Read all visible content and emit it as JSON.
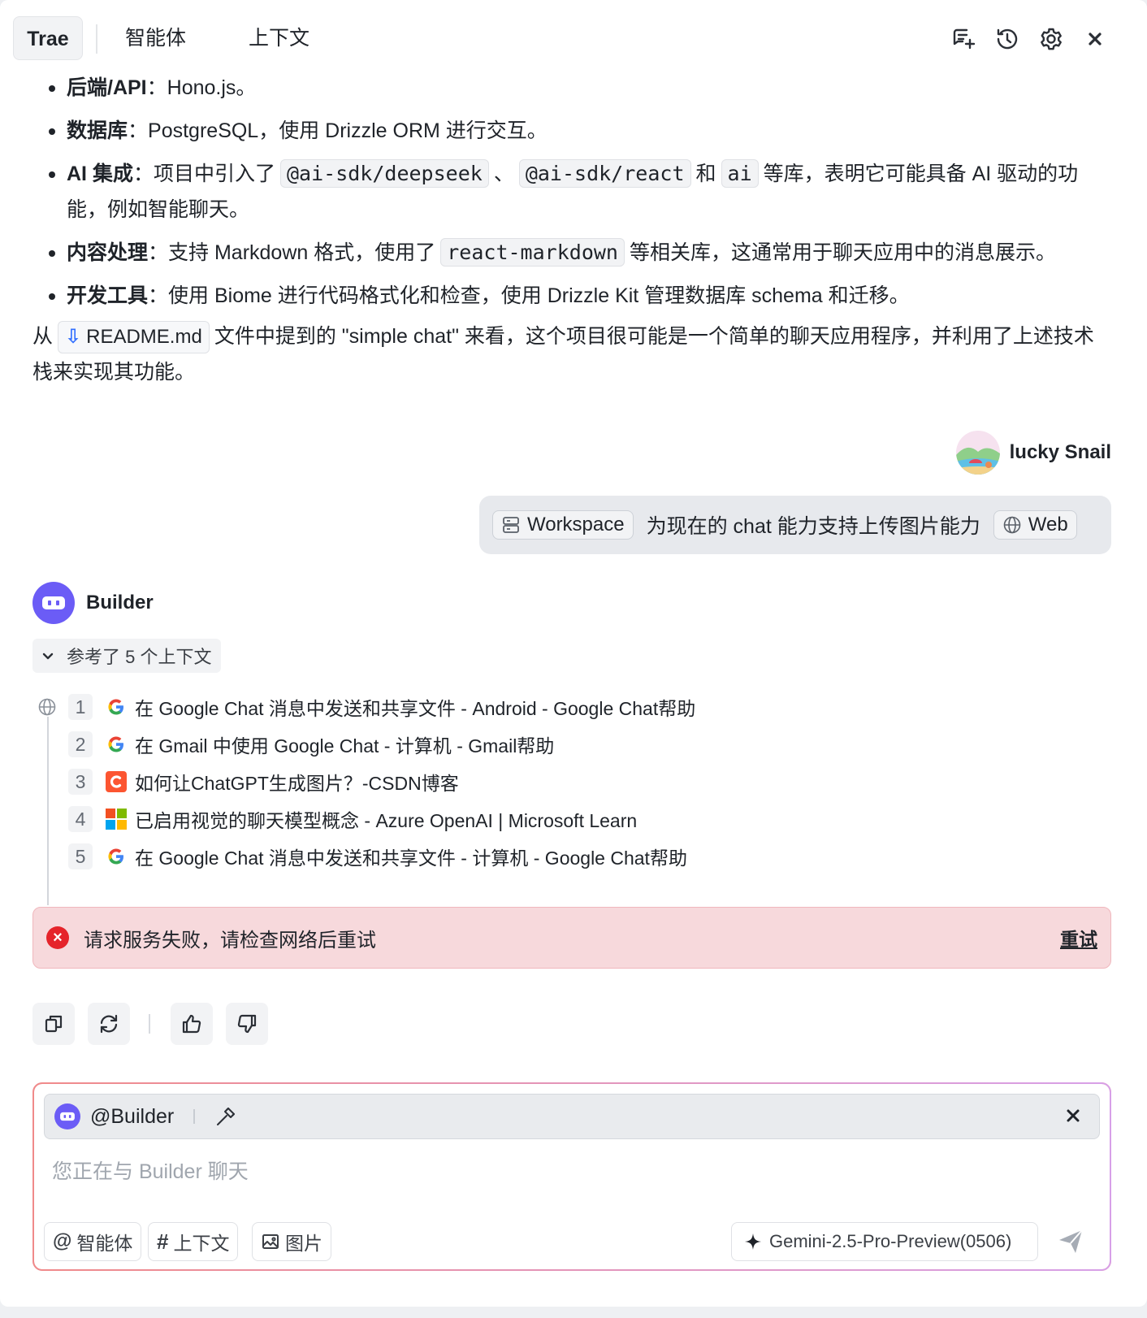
{
  "header": {
    "tabs": [
      "Trae",
      "智能体",
      "上下文"
    ],
    "icons": [
      "new-chat-icon",
      "history-icon",
      "settings-icon",
      "close-icon"
    ]
  },
  "bullets": [
    {
      "label": "后端/API",
      "sep": "：",
      "text": "Hono.js。"
    },
    {
      "label": "数据库",
      "sep": "：",
      "text": "PostgreSQL，使用 Drizzle ORM 进行交互。"
    },
    {
      "label": "AI 集成",
      "sep": "：",
      "pre": "项目中引入了",
      "code1": "@ai-sdk/deepseek",
      "mid1": "、",
      "code2": "@ai-sdk/react",
      "mid2": "和",
      "code3": "ai",
      "post": "等库，表明它可能具备 AI 驱动的功能，例如智能聊天。"
    },
    {
      "label": "内容处理",
      "sep": "：",
      "pre": "支持 Markdown 格式，使用了",
      "code1": "react-markdown",
      "post": "等相关库，这通常用于聊天应用中的消息展示。"
    },
    {
      "label": "开发工具",
      "sep": "：",
      "text": "使用 Biome 进行代码格式化和检查，使用 Drizzle Kit 管理数据库 schema 和迁移。"
    }
  ],
  "summary": {
    "pre": "从",
    "file": "README.md",
    "post": "文件中提到的 \"simple chat\" 来看，这个项目很可能是一个简单的聊天应用程序，并利用了上述技术栈来实现其功能。"
  },
  "user": {
    "name": "lucky Snail",
    "workspace_chip": "Workspace",
    "message": "为现在的 chat 能力支持上传图片能力",
    "web_chip": "Web"
  },
  "builder": {
    "name": "Builder",
    "context_toggle": "参考了 5 个上下文",
    "references": [
      {
        "num": "1",
        "icon": "google",
        "title": "在 Google Chat 消息中发送和共享文件 - Android - Google Chat帮助"
      },
      {
        "num": "2",
        "icon": "google",
        "title": "在 Gmail 中使用 Google Chat - 计算机 - Gmail帮助"
      },
      {
        "num": "3",
        "icon": "csdn",
        "title": "如何让ChatGPT生成图片？-CSDN博客"
      },
      {
        "num": "4",
        "icon": "microsoft",
        "title": "已启用视觉的聊天模型概念 - Azure OpenAI | Microsoft Learn"
      },
      {
        "num": "5",
        "icon": "google",
        "title": "在 Google Chat 消息中发送和共享文件 - 计算机 - Google Chat帮助"
      }
    ]
  },
  "error": {
    "message": "请求服务失败，请检查网络后重试",
    "retry": "重试"
  },
  "composer": {
    "agent": "@Builder",
    "placeholder": "您正在与 Builder 聊天",
    "buttons": {
      "agent": "智能体",
      "context": "上下文",
      "image": "图片"
    },
    "model": "Gemini-2.5-Pro-Preview(0506)"
  },
  "colors": {
    "accent": "#6b5cf6",
    "error_bg": "#f7d9dc",
    "error_icon": "#e5242b"
  }
}
